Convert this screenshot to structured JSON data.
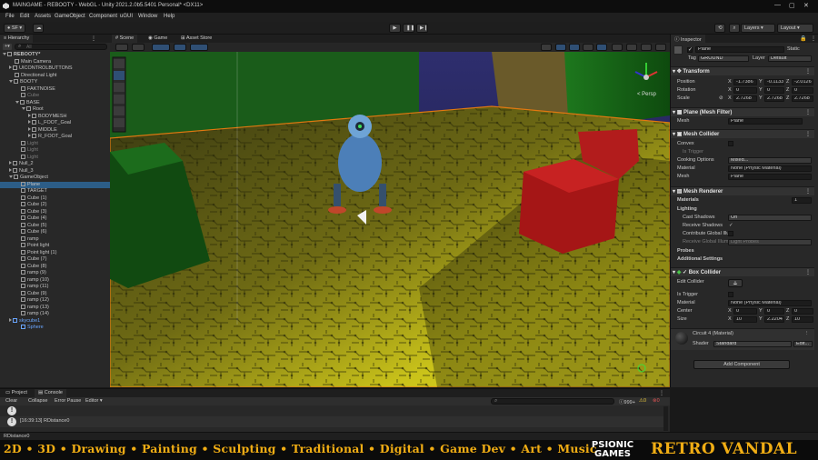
{
  "window": {
    "title": "MAINGAME - REBOOTY - WebGL - Unity 2021.2.0b5.5401 Personal* <DX11>",
    "controls": [
      "—",
      "▢",
      "✕"
    ]
  },
  "menu": [
    "File",
    "Edit",
    "Assets",
    "GameObject",
    "Component",
    "uGUI",
    "Window",
    "Help"
  ],
  "toolbar": {
    "account": "SF",
    "layers": "Layers",
    "layout": "Layout"
  },
  "hierarchy": {
    "tab": "Hierarchy",
    "search_placeholder": "All",
    "rows": [
      {
        "label": "REBOOTY*",
        "indent": 0,
        "kind": "scene",
        "expanded": true
      },
      {
        "label": "Main Camera",
        "indent": 1,
        "kind": "obj"
      },
      {
        "label": "UICONTROLBUTTONS",
        "indent": 1,
        "kind": "obj",
        "expanded": false
      },
      {
        "label": "Directional Light",
        "indent": 1,
        "kind": "obj"
      },
      {
        "label": "BOOTY",
        "indent": 1,
        "kind": "obj",
        "expanded": true
      },
      {
        "label": "FAKTNOISE",
        "indent": 2,
        "kind": "obj"
      },
      {
        "label": "Cube",
        "indent": 2,
        "kind": "obj",
        "dim": true
      },
      {
        "label": "BASE",
        "indent": 2,
        "kind": "obj",
        "expanded": true
      },
      {
        "label": "Root",
        "indent": 3,
        "kind": "obj",
        "expanded": true
      },
      {
        "label": "BODYMESH",
        "indent": 4,
        "kind": "obj",
        "expanded": false
      },
      {
        "label": "L_FOOT_Goal",
        "indent": 4,
        "kind": "obj",
        "expanded": false
      },
      {
        "label": "MIDDLE",
        "indent": 4,
        "kind": "obj",
        "expanded": false
      },
      {
        "label": "R_FOOT_Goal",
        "indent": 4,
        "kind": "obj",
        "expanded": false
      },
      {
        "label": "Light",
        "indent": 2,
        "kind": "obj",
        "dim": true
      },
      {
        "label": "Light",
        "indent": 2,
        "kind": "obj",
        "dim": true
      },
      {
        "label": "Light",
        "indent": 2,
        "kind": "obj",
        "dim": true
      },
      {
        "label": "Null_2",
        "indent": 1,
        "kind": "obj",
        "expanded": false
      },
      {
        "label": "Null_3",
        "indent": 1,
        "kind": "obj",
        "expanded": false
      },
      {
        "label": "GameObject",
        "indent": 1,
        "kind": "obj",
        "expanded": true
      },
      {
        "label": "Plane",
        "indent": 2,
        "kind": "obj",
        "selected": true
      },
      {
        "label": "TARGET",
        "indent": 2,
        "kind": "obj"
      },
      {
        "label": "Cube (1)",
        "indent": 2,
        "kind": "obj"
      },
      {
        "label": "Cube (2)",
        "indent": 2,
        "kind": "obj"
      },
      {
        "label": "Cube (3)",
        "indent": 2,
        "kind": "obj"
      },
      {
        "label": "Cube (4)",
        "indent": 2,
        "kind": "obj"
      },
      {
        "label": "Cube (5)",
        "indent": 2,
        "kind": "obj"
      },
      {
        "label": "Cube (6)",
        "indent": 2,
        "kind": "obj"
      },
      {
        "label": "ramp",
        "indent": 2,
        "kind": "obj"
      },
      {
        "label": "Point light",
        "indent": 2,
        "kind": "obj"
      },
      {
        "label": "Point light (1)",
        "indent": 2,
        "kind": "obj"
      },
      {
        "label": "Cube (7)",
        "indent": 2,
        "kind": "obj"
      },
      {
        "label": "Cube (8)",
        "indent": 2,
        "kind": "obj"
      },
      {
        "label": "ramp (9)",
        "indent": 2,
        "kind": "obj"
      },
      {
        "label": "ramp (10)",
        "indent": 2,
        "kind": "obj"
      },
      {
        "label": "ramp (11)",
        "indent": 2,
        "kind": "obj"
      },
      {
        "label": "Cube (9)",
        "indent": 2,
        "kind": "obj"
      },
      {
        "label": "ramp (12)",
        "indent": 2,
        "kind": "obj"
      },
      {
        "label": "ramp (13)",
        "indent": 2,
        "kind": "obj"
      },
      {
        "label": "ramp (14)",
        "indent": 2,
        "kind": "obj"
      },
      {
        "label": "skycube1",
        "indent": 1,
        "kind": "obj",
        "blue": true,
        "expanded": false
      },
      {
        "label": "Sphere",
        "indent": 2,
        "kind": "obj",
        "blue": true
      }
    ]
  },
  "scene": {
    "tabs": [
      "Scene",
      "Game",
      "Asset Store"
    ],
    "active_tab": "Scene",
    "gizmo_label": "< Persp",
    "render_mode": "2D"
  },
  "play": {
    "play": "▶",
    "pause": "❚❚",
    "step": "▶❙"
  },
  "console": {
    "tabs": [
      "Project",
      "Console"
    ],
    "active_tab": "Console",
    "buttons": [
      "Clear",
      "Collapse",
      "Error Pause",
      "Editor"
    ],
    "count": "999+",
    "count_warn": "0",
    "count_err": "0",
    "entry": "[16:39:13] RDistance0",
    "status": "RDistance0"
  },
  "inspector": {
    "tab": "Inspector",
    "name": "Plane",
    "static_label": "Static",
    "tag_label": "Tag",
    "tag": "GROUND",
    "layer_label": "Layer",
    "layer": "Default",
    "transform": {
      "title": "Transform",
      "position": {
        "label": "Position",
        "x": "-1.7386",
        "y": "-0.1133",
        "z": "-2.0126"
      },
      "rotation": {
        "label": "Rotation",
        "x": "0",
        "y": "0",
        "z": "0"
      },
      "scale": {
        "label": "Scale",
        "x": "2.7268",
        "y": "2.7268",
        "z": "2.7268"
      }
    },
    "mesh_filter": {
      "title": "Plane (Mesh Filter)",
      "mesh_label": "Mesh",
      "mesh": "Plane"
    },
    "mesh_collider": {
      "title": "Mesh Collider",
      "convex": "Convex",
      "is_trigger": "Is Trigger",
      "cooking_label": "Cooking Options",
      "cooking": "Mixed...",
      "material_label": "Material",
      "material": "None (Physic Material)",
      "mesh_label": "Mesh",
      "mesh": "Plane"
    },
    "mesh_renderer": {
      "title": "Mesh Renderer",
      "materials": "Materials",
      "materials_count": "1",
      "lighting": "Lighting",
      "cast_label": "Cast Shadows",
      "cast": "On",
      "receive_label": "Receive Shadows",
      "contribute_label": "Contribute Global Illumination",
      "receive_gi_label": "Receive Global Illumination",
      "receive_gi": "Light Probes",
      "probes": "Probes",
      "additional": "Additional Settings"
    },
    "box_collider": {
      "title": "Box Collider",
      "edit_label": "Edit Collider",
      "trigger_label": "Is Trigger",
      "material_label": "Material",
      "material": "None (Physic Material)",
      "center": {
        "label": "Center",
        "x": "0",
        "y": "0",
        "z": "0"
      },
      "size": {
        "label": "Size",
        "x": "10",
        "y": "2.2204",
        "z": "10"
      }
    },
    "material": {
      "title": "Circuit 4 (Material)",
      "shader_label": "Shader",
      "shader": "Standard",
      "edit": "Edit..."
    },
    "add_component": "Add Component"
  },
  "banner": {
    "tags": "2D • 3D • Drawing • Painting • Sculpting • Traditional • Digital • Game Dev • Art • Music",
    "brand_line1": "PSIONIC",
    "brand_line2": "GAMES",
    "retro": "RETRO VANDAL"
  },
  "colors": {
    "accent": "#f0ad14",
    "selection": "#2c5d87",
    "panel": "#282828"
  }
}
